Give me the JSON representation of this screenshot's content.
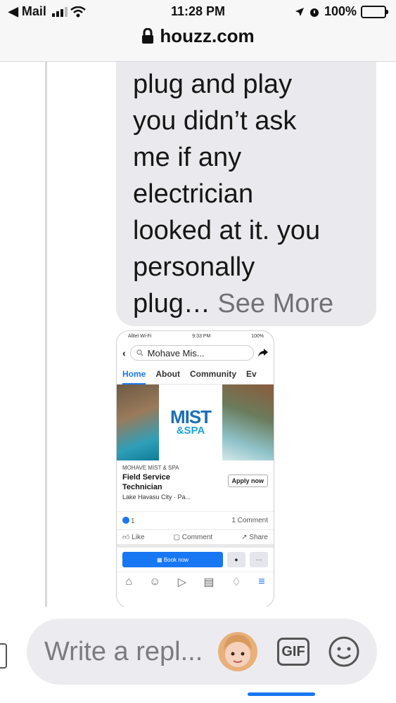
{
  "status_bar": {
    "back_app": "◀ Mail",
    "time": "11:28 PM",
    "battery": "100%"
  },
  "browser": {
    "url": "houzz.com"
  },
  "message": {
    "text": "plug and play\nyou didn’t ask\nme if any\nelectrician\nlooked at it.  you\npersonally\nplug… ",
    "see_more": "See More"
  },
  "attachment": {
    "status_carrier": "Alltel Wi-Fi",
    "status_time": "9:33 PM",
    "status_battery": "100%",
    "search_text": "Mohave Mis...",
    "tabs": [
      "Home",
      "About",
      "Community",
      "Ev"
    ],
    "logo_line1": "MIST",
    "logo_line2": "&SPA",
    "company": "MOHAVE MIST & SPA",
    "job_title": "Field Service Technician",
    "location": "Lake Havasu City · Pa...",
    "apply_label": "Apply now",
    "reaction_count": "1",
    "comment_count": "1 Comment",
    "like_label": "Like",
    "comment_label": "Comment",
    "share_label": "Share",
    "book_label": "Book now"
  },
  "composer": {
    "placeholder": "Write a repl...",
    "gif_label": "GIF"
  },
  "colors": {
    "accent": "#1877f2",
    "battery": "#34c759",
    "bubble": "#eaeaee"
  }
}
